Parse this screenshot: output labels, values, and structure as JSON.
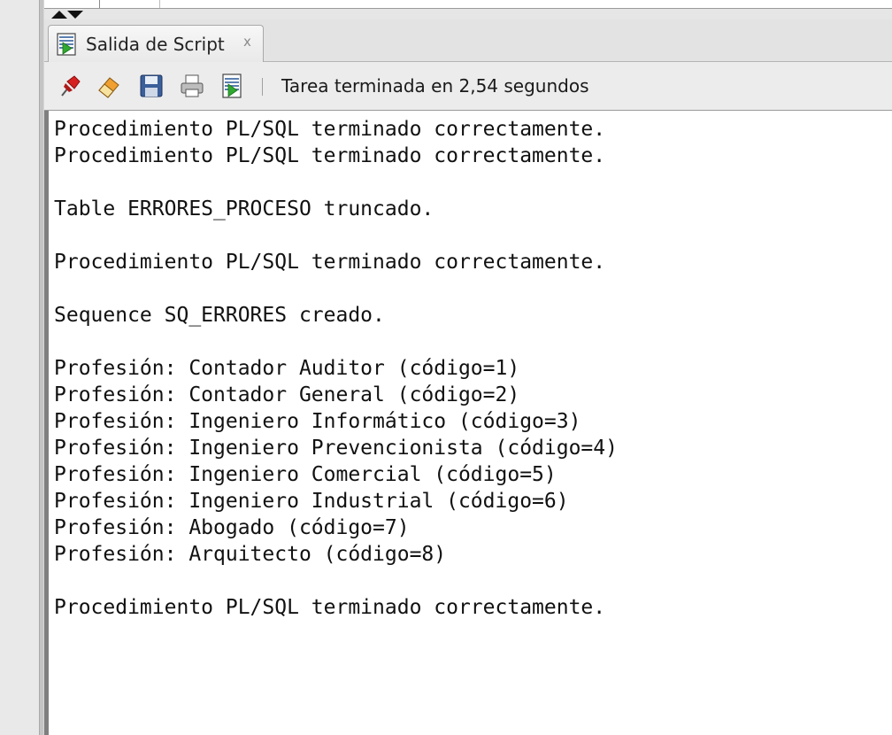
{
  "panel": {
    "tab_label": "Salida de Script",
    "tab_close": "x"
  },
  "toolbar": {
    "buttons": [
      {
        "name": "pin",
        "icon": "pin-icon"
      },
      {
        "name": "clear",
        "icon": "eraser-icon"
      },
      {
        "name": "save",
        "icon": "floppy-disk-icon"
      },
      {
        "name": "print",
        "icon": "printer-icon"
      },
      {
        "name": "run-script",
        "icon": "script-output-icon"
      }
    ],
    "status": "Tarea terminada en 2,54 segundos"
  },
  "output": {
    "lines": [
      "Procedimiento PL/SQL terminado correctamente.",
      "Procedimiento PL/SQL terminado correctamente.",
      "",
      "Table ERRORES_PROCESO truncado.",
      "",
      "Procedimiento PL/SQL terminado correctamente.",
      "",
      "Sequence SQ_ERRORES creado.",
      "",
      "Profesión: Contador Auditor (código=1)",
      "Profesión: Contador General (código=2)",
      "Profesión: Ingeniero Informático (código=3)",
      "Profesión: Ingeniero Prevencionista (código=4)",
      "Profesión: Ingeniero Comercial (código=5)",
      "Profesión: Ingeniero Industrial (código=6)",
      "Profesión: Abogado (código=7)",
      "Profesión: Arquitecto (código=8)",
      "",
      "Procedimiento PL/SQL terminado correctamente."
    ]
  },
  "colors": {
    "background": "#ececec",
    "output_background": "#ffffff",
    "text": "#111111"
  }
}
